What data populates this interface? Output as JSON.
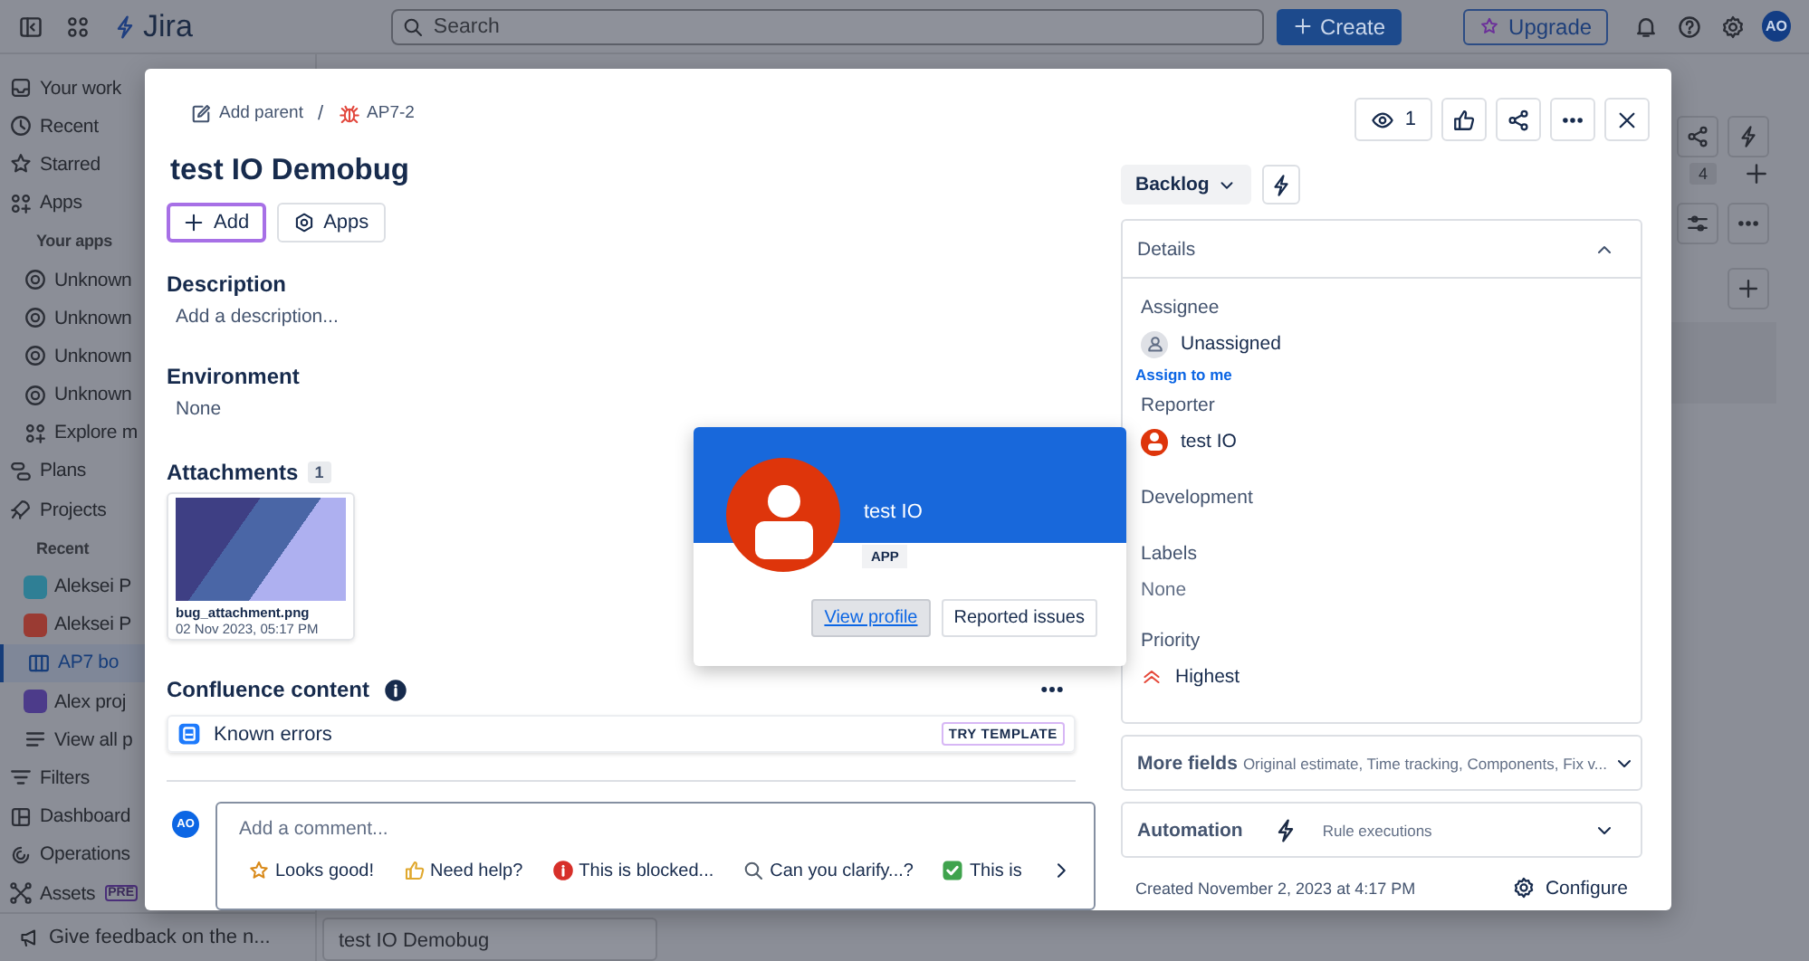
{
  "top_bar": {
    "product": "Jira",
    "search": {
      "placeholder": "Search"
    },
    "create": "Create",
    "upgrade": "Upgrade",
    "avatar": "AO"
  },
  "sidebar": {
    "items": [
      {
        "kind": "link",
        "label": "Your work",
        "selected": false
      },
      {
        "kind": "link",
        "label": "Recent",
        "selected": false
      },
      {
        "kind": "link",
        "label": "Starred",
        "selected": false
      },
      {
        "kind": "link",
        "label": "Apps",
        "selected": false
      },
      {
        "kind": "heading",
        "label": "Your apps"
      },
      {
        "kind": "sub",
        "label": "Unknown",
        "selected": false
      },
      {
        "kind": "sub",
        "label": "Unknown",
        "selected": false
      },
      {
        "kind": "sub",
        "label": "Unknown",
        "selected": false
      },
      {
        "kind": "sub",
        "label": "Unknown",
        "selected": false
      },
      {
        "kind": "sub",
        "label": "Explore m",
        "selected": false
      },
      {
        "kind": "link",
        "label": "Plans",
        "selected": false
      },
      {
        "kind": "link",
        "label": "Projects",
        "selected": false
      },
      {
        "kind": "heading",
        "label": "Recent"
      },
      {
        "kind": "project",
        "label": "Aleksei P",
        "color": "#2f7f95",
        "selected": false
      },
      {
        "kind": "project",
        "label": "Aleksei P",
        "color": "#9a3b33",
        "selected": false
      },
      {
        "kind": "sub",
        "label": "AP7 bo",
        "selected": true
      },
      {
        "kind": "project",
        "label": "Alex proj",
        "color": "#4c3b8a",
        "selected": false
      },
      {
        "kind": "sub",
        "label": "View all p",
        "selected": false
      },
      {
        "kind": "link",
        "label": "Filters",
        "selected": false
      },
      {
        "kind": "link",
        "label": "Dashboard",
        "selected": false
      },
      {
        "kind": "link",
        "label": "Operations",
        "selected": false
      },
      {
        "kind": "link",
        "label": "Assets",
        "badge": "PRE",
        "selected": false
      }
    ],
    "feedback": "Give feedback on the n..."
  },
  "board": {
    "column_count": "4",
    "cards": [
      "test IO Demobug"
    ]
  },
  "issue": {
    "breadcrumb": {
      "parent": "Add parent",
      "separator": "/",
      "key": "AP7-2"
    },
    "watchers": "1",
    "title": "test IO Demobug",
    "actions": [
      {
        "label": "Add",
        "selected": true
      },
      {
        "label": "Apps",
        "selected": false
      }
    ],
    "sections": [
      {
        "heading": "Description",
        "value": "Add a description..."
      },
      {
        "heading": "Environment",
        "value": "None"
      }
    ],
    "attachments": {
      "heading": "Attachments",
      "count": "1",
      "files": [
        {
          "name": "bug_attachment.png",
          "date": "02 Nov 2023, 05:17 PM"
        }
      ]
    },
    "confluence": {
      "heading": "Confluence content",
      "pages": [
        {
          "title": "Known errors",
          "badge": "TRY TEMPLATE"
        }
      ]
    },
    "comment": {
      "avatar": "AO",
      "placeholder": "Add a comment...",
      "quick_replies": [
        {
          "label": "Looks good!"
        },
        {
          "label": "Need help?"
        },
        {
          "label": "This is blocked..."
        },
        {
          "label": "Can you clarify...?"
        },
        {
          "label": "This is"
        }
      ]
    },
    "status": "Backlog",
    "details": {
      "heading": "Details",
      "expanded": true,
      "fields": [
        {
          "kind": "unassigned",
          "label": "Assignee",
          "value": "Unassigned",
          "link": "Assign to me"
        },
        {
          "kind": "user",
          "label": "Reporter",
          "value": "test IO"
        },
        {
          "kind": "empty",
          "label": "Development"
        },
        {
          "kind": "text",
          "label": "Labels",
          "value": "None"
        },
        {
          "kind": "priority",
          "label": "Priority",
          "value": "Highest"
        }
      ]
    },
    "more_fields": {
      "heading": "More fields",
      "summary": "Original estimate, Time tracking, Components, Fix v..."
    },
    "automation": {
      "heading": "Automation",
      "summary": "Rule executions"
    },
    "created": "Created November 2, 2023 at 4:17 PM",
    "configure": "Configure"
  },
  "profile_card": {
    "name": "test IO",
    "badge": "APP",
    "buttons": [
      {
        "label": "View profile",
        "selected": true
      },
      {
        "label": "Reported issues",
        "selected": false
      }
    ]
  }
}
